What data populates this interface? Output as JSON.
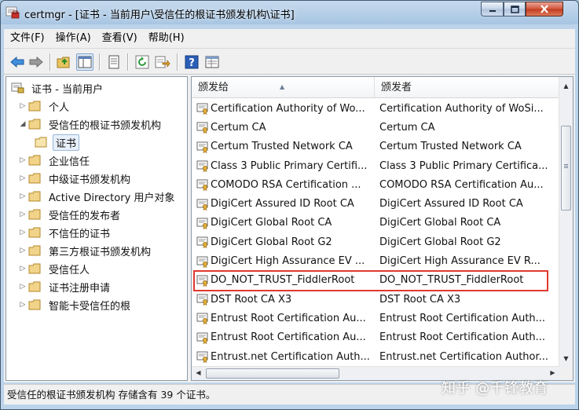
{
  "window": {
    "title": "certmgr - [证书 - 当前用户\\受信任的根证书颁发机构\\证书]"
  },
  "menu": [
    {
      "label": "文件(F)"
    },
    {
      "label": "操作(A)"
    },
    {
      "label": "查看(V)"
    },
    {
      "label": "帮助(H)"
    }
  ],
  "toolbar": {
    "icons": [
      "back-arrow-icon",
      "forward-arrow-icon",
      "up-folder-icon",
      "show-hide-tree-icon",
      "properties-icon",
      "refresh-icon",
      "export-list-icon",
      "help-icon",
      "console-tree-icon"
    ]
  },
  "tree": {
    "root": "证书 - 当前用户",
    "items": [
      {
        "label": "个人",
        "expanded": false
      },
      {
        "label": "受信任的根证书颁发机构",
        "expanded": true
      },
      {
        "label": "证书",
        "selected": true
      },
      {
        "label": "企业信任",
        "expanded": false
      },
      {
        "label": "中级证书颁发机构",
        "expanded": false
      },
      {
        "label": "Active Directory 用户对象",
        "expanded": false
      },
      {
        "label": "受信任的发布者",
        "expanded": false
      },
      {
        "label": "不信任的证书",
        "expanded": false
      },
      {
        "label": "第三方根证书颁发机构",
        "expanded": false
      },
      {
        "label": "受信任人",
        "expanded": false
      },
      {
        "label": "证书注册申请",
        "expanded": false
      },
      {
        "label": "智能卡受信任的根",
        "expanded": false
      }
    ]
  },
  "list": {
    "columns": [
      "颁发给",
      "颁发者"
    ],
    "rows": [
      {
        "issued_to": "Certification Authority of Wo...",
        "issued_by": "Certification Authority of WoSi..."
      },
      {
        "issued_to": "Certum CA",
        "issued_by": "Certum CA"
      },
      {
        "issued_to": "Certum Trusted Network CA",
        "issued_by": "Certum Trusted Network CA"
      },
      {
        "issued_to": "Class 3 Public Primary Certifi...",
        "issued_by": "Class 3 Public Primary Certifica..."
      },
      {
        "issued_to": "COMODO RSA Certification ...",
        "issued_by": "COMODO RSA Certification Au..."
      },
      {
        "issued_to": "DigiCert Assured ID Root CA",
        "issued_by": "DigiCert Assured ID Root CA"
      },
      {
        "issued_to": "DigiCert Global Root CA",
        "issued_by": "DigiCert Global Root CA"
      },
      {
        "issued_to": "DigiCert Global Root G2",
        "issued_by": "DigiCert Global Root G2"
      },
      {
        "issued_to": "DigiCert High Assurance EV ...",
        "issued_by": "DigiCert High Assurance EV R..."
      },
      {
        "issued_to": "DO_NOT_TRUST_FiddlerRoot",
        "issued_by": "DO_NOT_TRUST_FiddlerRoot",
        "highlighted": true
      },
      {
        "issued_to": "DST Root CA X3",
        "issued_by": "DST Root CA X3"
      },
      {
        "issued_to": "Entrust Root Certification Au...",
        "issued_by": "Entrust Root Certification Auth..."
      },
      {
        "issued_to": "Entrust Root Certification Au...",
        "issued_by": "Entrust Root Certification Auth..."
      },
      {
        "issued_to": "Entrust.net Certification Auth...",
        "issued_by": "Entrust.net Certification Author..."
      }
    ]
  },
  "statusbar": {
    "text": "受信任的根证书颁发机构 存储含有 39 个证书。"
  },
  "watermark": "知乎 @千锋教育",
  "colors": {
    "highlight_border": "#e0392e",
    "title_gradient_top": "#c6daee",
    "close_button": "#c23a1e"
  }
}
